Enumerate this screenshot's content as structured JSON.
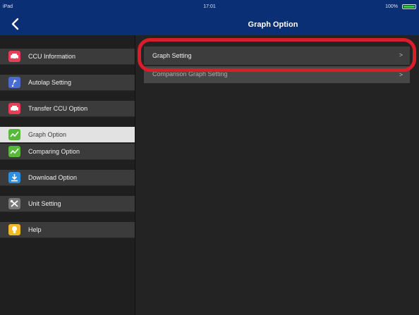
{
  "status_bar": {
    "device": "iPad",
    "time": "17:01",
    "battery": "100%",
    "battery_level": 1.0
  },
  "nav": {
    "title": "Graph Option",
    "back_icon": "chevron-left-icon"
  },
  "sidebar": {
    "items": [
      {
        "label": "CCU Information",
        "icon": "car-icon",
        "color": "#e83e58"
      },
      {
        "label": "Autolap Setting",
        "icon": "map-pin-icon",
        "color": "#4a6cd0"
      },
      {
        "label": "Transfer CCU Option",
        "icon": "car-icon",
        "color": "#e83e58"
      },
      {
        "label": "Graph Option",
        "icon": "line-chart-icon",
        "color": "#58b83a",
        "selected": true
      },
      {
        "label": "Comparing Option",
        "icon": "line-chart-icon",
        "color": "#58b83a"
      },
      {
        "label": "Download Option",
        "icon": "download-icon",
        "color": "#2d8fe0"
      },
      {
        "label": "Unit Setting",
        "icon": "tools-icon",
        "color": "#7a7a7a"
      },
      {
        "label": "Help",
        "icon": "lightbulb-icon",
        "color": "#f0b82a"
      }
    ]
  },
  "content": {
    "rows": [
      {
        "label": "Graph Setting",
        "chevron": ">"
      },
      {
        "label": "Comparison Graph Setting",
        "chevron": ">"
      }
    ]
  },
  "colors": {
    "nav_bar": "#0b2f74",
    "highlight": "#d71e2a",
    "selected_row": "#e2e2e2"
  }
}
